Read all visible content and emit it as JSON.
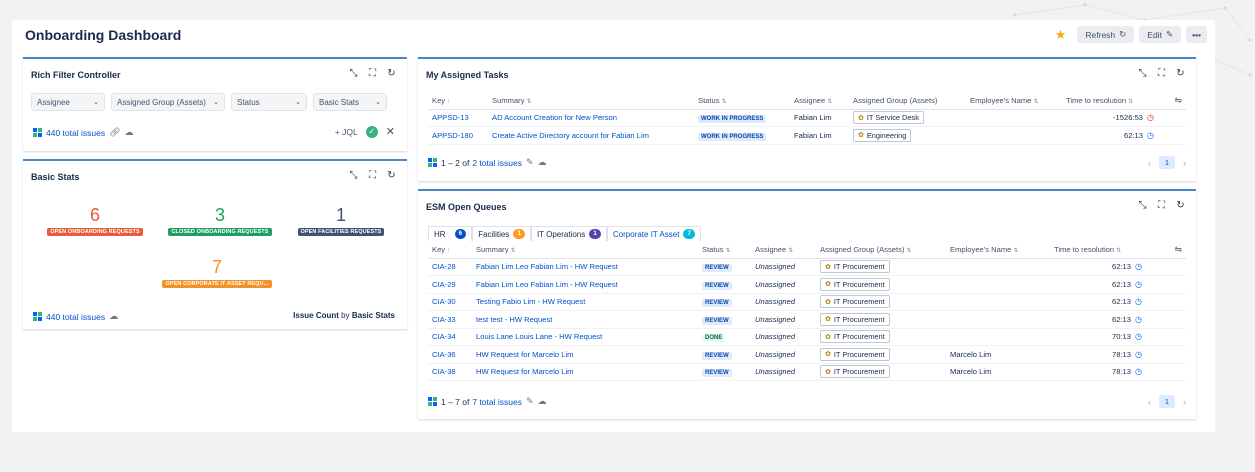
{
  "header": {
    "title": "Onboarding Dashboard",
    "refresh_label": "Refresh",
    "edit_label": "Edit",
    "more_label": "•••"
  },
  "rich_filter": {
    "title": "Rich Filter Controller",
    "filters": [
      "Assignee",
      "Assigned Group (Assets)",
      "Status",
      "Basic Stats"
    ],
    "total_issues": "440 total issues",
    "jql_label": "+ JQL"
  },
  "basic_stats": {
    "title": "Basic Stats",
    "stats": [
      {
        "value": "6",
        "label": "OPEN ONBOARDING REQUESTS",
        "color": "#e65b3b"
      },
      {
        "value": "3",
        "label": "CLOSED ONBOARDING REQUESTS",
        "color": "#1f9e63"
      },
      {
        "value": "1",
        "label": "OPEN FACILITIES REQUESTS",
        "color": "#42526e"
      },
      {
        "value": "7",
        "label": "OPEN CORPORATE IT ASSET REQU...",
        "color": "#f4902a"
      }
    ],
    "total_issues": "440 total issues",
    "footer_prefix": "Issue Count",
    "footer_by": "by",
    "footer_suffix": "Basic Stats"
  },
  "my_tasks": {
    "title": "My Assigned Tasks",
    "columns": [
      "Key",
      "Summary",
      "Status",
      "Assignee",
      "Assigned Group (Assets)",
      "Employee's Name",
      "Time to resolution"
    ],
    "rows": [
      {
        "key": "APPSD-13",
        "summary": "AD Account Creation for New Person",
        "status": "WORK IN PROGRESS",
        "assignee": "Fabian Lim",
        "group": "IT Service Desk",
        "employee": "",
        "time": "-1526:53"
      },
      {
        "key": "APPSD-180",
        "summary": "Create Active Directory account for Fabian Lim",
        "status": "WORK IN PROGRESS",
        "assignee": "Fabian Lim",
        "group": "Engineering",
        "employee": "",
        "time": "62:13"
      }
    ],
    "range": "1 – 2 of",
    "total": "2 total issues",
    "page": "1"
  },
  "esm": {
    "title": "ESM Open Queues",
    "tabs": [
      {
        "label": "HR",
        "count": "6",
        "color": "#0052cc"
      },
      {
        "label": "Facilities",
        "count": "1",
        "color": "#ff991f"
      },
      {
        "label": "IT Operations",
        "count": "1",
        "color": "#5243aa"
      },
      {
        "label": "Corporate IT Asset",
        "count": "7",
        "color": "#00b8d9"
      }
    ],
    "columns": [
      "Key",
      "Summary",
      "Status",
      "Assignee",
      "Assigned Group (Assets)",
      "Employee's Name",
      "Time to resolution"
    ],
    "rows": [
      {
        "key": "CIA-28",
        "summary": "Fabian Lim Leo Fabian Lim - HW Request",
        "status": "REVIEW",
        "assignee": "Unassigned",
        "group": "IT Procurement",
        "employee": "",
        "time": "62:13"
      },
      {
        "key": "CIA-29",
        "summary": "Fabian Lim Leo Fabian Lim - HW Request",
        "status": "REVIEW",
        "assignee": "Unassigned",
        "group": "IT Procurement",
        "employee": "",
        "time": "62:13"
      },
      {
        "key": "CIA-30",
        "summary": "Testing Fabio Lim - HW Request",
        "status": "REVIEW",
        "assignee": "Unassigned",
        "group": "IT Procurement",
        "employee": "",
        "time": "62:13"
      },
      {
        "key": "CIA-33",
        "summary": "test test - HW Request",
        "status": "REVIEW",
        "assignee": "Unassigned",
        "group": "IT Procurement",
        "employee": "",
        "time": "62:13"
      },
      {
        "key": "CIA-34",
        "summary": "Louis Lane Louis Lane - HW Request",
        "status": "DONE",
        "assignee": "Unassigned",
        "group": "IT Procurement",
        "employee": "",
        "time": "70:13"
      },
      {
        "key": "CIA-36",
        "summary": "HW Request for Marcelo Lim",
        "status": "REVIEW",
        "assignee": "Unassigned",
        "group": "IT Procurement",
        "employee": "Marcelo Lim",
        "time": "78:13"
      },
      {
        "key": "CIA-38",
        "summary": "HW Request for Marcelo Lim",
        "status": "REVIEW",
        "assignee": "Unassigned",
        "group": "IT Procurement",
        "employee": "Marcelo Lim",
        "time": "78:13"
      }
    ],
    "range": "1 – 7 of",
    "total": "7 total issues",
    "page": "1"
  }
}
